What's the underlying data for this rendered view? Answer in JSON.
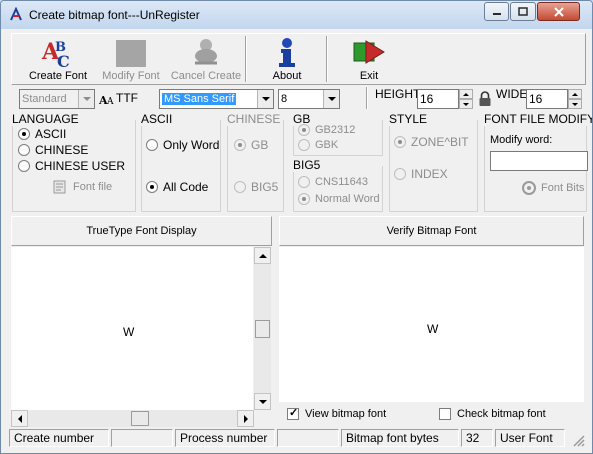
{
  "window": {
    "title": "Create bitmap font---UnRegister"
  },
  "toolbar": {
    "create_font": "Create Font",
    "modify_font": "Modify Font",
    "cancel_create": "Cancel Create",
    "about": "About",
    "exit": "Exit"
  },
  "options": {
    "style_select": "Standard",
    "ttf_label": "TTF",
    "font_name": "MS Sans Serif",
    "font_size": "8",
    "height_label": "HEIGHT",
    "height_value": "16",
    "wide_label": "WIDE",
    "wide_value": "16"
  },
  "language": {
    "title": "LANGUAGE",
    "options": [
      "ASCII",
      "CHINESE",
      "CHINESE USER"
    ],
    "selected": "ASCII",
    "font_file_button": "Font file"
  },
  "ascii": {
    "title": "ASCII",
    "options": [
      "Only Word",
      "All Code"
    ],
    "selected": "All Code"
  },
  "chinese": {
    "title": "CHINESE",
    "options": [
      "GB",
      "BIG5"
    ]
  },
  "gb": {
    "title": "GB",
    "options": [
      "GB2312",
      "GBK"
    ]
  },
  "big5": {
    "title": "BIG5",
    "options": [
      "CNS11643",
      "Normal Word"
    ]
  },
  "style": {
    "title": "STYLE",
    "options": [
      "ZONE^BIT",
      "INDEX"
    ]
  },
  "font_file_modify": {
    "title": "FONT FILE MODIFY",
    "modify_word_label": "Modify word:",
    "modify_word_value": "",
    "font_bits_button": "Font Bits"
  },
  "panels": {
    "truetype_title": "TrueType Font Display",
    "verify_title": "Verify Bitmap Font",
    "truetype_glyph": "W",
    "verify_glyph": "W",
    "view_bitmap_font": "View bitmap font",
    "check_bitmap_font": "Check bitmap font"
  },
  "status": {
    "create_number_label": "Create number",
    "create_number_value": "",
    "process_number_label": "Process number",
    "process_number_value": "",
    "bitmap_font_bytes_label": "Bitmap font bytes",
    "bitmap_font_bytes_value": "32",
    "user_font": "User Font"
  }
}
